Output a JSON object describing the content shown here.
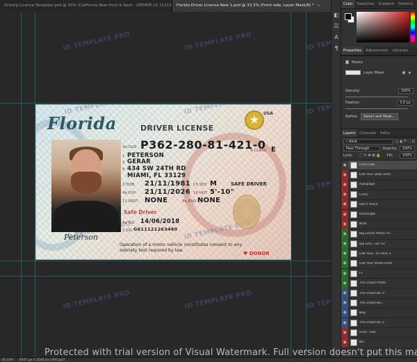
{
  "tabs": [
    {
      "label": "Driving Licence Template.psd @ 50% (California New front & back - UPDATE-22 21111, RGB/8#) *",
      "close": "×"
    },
    {
      "label": "Florida Driver License New 1.psd @ 33.3% (Front side, Layer Mask/8) *",
      "close": "×"
    }
  ],
  "watermark_text": "ID TEMPLATE PRO",
  "card": {
    "state": "Florida",
    "title": "DRIVER LICENSE",
    "country": "USA",
    "dl_label": "4d DLN",
    "dl_number": "P362-280-81-421-0",
    "class_label": "9 CLASS",
    "class_value": "E",
    "ln_num": "1",
    "last_name": "PETERSON",
    "fn_num": "2",
    "first_name": "GERAR",
    "addr_num": "8",
    "address1": "434 SW 24TH RD",
    "address2": "MIAMI, FL 33129",
    "dob_label": "3 DOB",
    "dob": "21/11/1981",
    "exp_label": "4b EXP",
    "exp": "21/11/2026",
    "rest_label": "12 REST",
    "rest": "NONE",
    "sex_label": "15 SEX",
    "sex": "M",
    "hgt_label": "16 HGT",
    "hgt": "5'-10\"",
    "end_label": "9a END",
    "end": "NONE",
    "safe_driver": "SAFE DRIVER",
    "safe_driver_red": "Safe Driver",
    "iss_label": "4a ISS",
    "iss": "14/06/2018",
    "dd_label": "5 DD",
    "dd": "G611121263480",
    "signature": "Peterson",
    "footer": "Operation of a motor vehicle constitutes consent to any sobriety test required by law.",
    "donor": "DONOR"
  },
  "panels": {
    "color_tabs": [
      "Color",
      "Swatches",
      "Gradient",
      "Patterns"
    ],
    "prop_tabs": [
      "Properties",
      "Adjustments",
      "Libraries"
    ],
    "masks_label": "Masks",
    "layer_mask_label": "Layer Mask",
    "density_label": "Density:",
    "density_value": "100%",
    "feather_label": "Feather:",
    "feather_value": "0.0 px",
    "refine_label": "Refine:",
    "select_and_mask": "Select and Mask...",
    "layers_tabs": [
      "Layers",
      "Channels",
      "Paths"
    ],
    "kind": "Kind",
    "blend_mode": "Pass Through",
    "opacity_label": "Opacity:",
    "opacity_value": "100%",
    "lock_label": "Lock:",
    "fill_label": "Fill:",
    "fill_value": "100%",
    "layers": [
      {
        "name": "Front side",
        "eye": "none",
        "sel": true
      },
      {
        "name": "Edit Your Data Here",
        "eye": "red"
      },
      {
        "name": "Autopage",
        "eye": "red"
      },
      {
        "name": "Lines",
        "eye": "red"
      },
      {
        "name": "Don't touch",
        "eye": "red"
      },
      {
        "name": "Rectangle",
        "eye": "red"
      },
      {
        "name": "NUN",
        "eye": "red"
      },
      {
        "name": "Big Ghost Photo ch...",
        "eye": "green"
      },
      {
        "name": "Big Gho...ion V2",
        "eye": "green"
      },
      {
        "name": "Edit Your...to Here 2",
        "eye": "green"
      },
      {
        "name": "Edit Your Photo Here",
        "eye": "green"
      },
      {
        "name": "FL",
        "eye": "green"
      },
      {
        "name": "The Ghost Photo",
        "eye": "green"
      },
      {
        "name": "The Ghost BG 3",
        "eye": "blue"
      },
      {
        "name": "The Ghost BG...",
        "eye": "blue"
      },
      {
        "name": "Bkg",
        "eye": "blue"
      },
      {
        "name": "The Ghost BG 2",
        "eye": "blue"
      },
      {
        "name": "Hue/...tion",
        "eye": "red"
      },
      {
        "name": "BG",
        "eye": "red"
      }
    ]
  },
  "status": {
    "zoom": "33.33%",
    "doc": "4047 px x 2540 px (300 ppi)"
  },
  "trial_banner": "Protected with trial version of Visual Watermark. Full version doesn't put this mark."
}
